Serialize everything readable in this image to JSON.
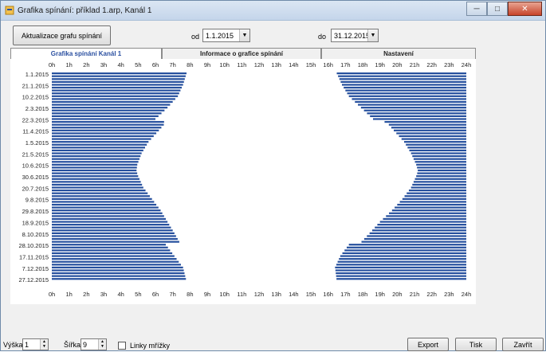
{
  "window": {
    "title": "Grafika spínání: příklad 1.arp, Kanál 1",
    "min_glyph": "─",
    "max_glyph": "□",
    "close_glyph": "✕"
  },
  "toolbar": {
    "refresh_label": "Aktualizace grafu spínání",
    "from_label": "od",
    "from_value": "1.1.2015",
    "to_label": "do",
    "to_value": "31.12.2015",
    "dropdown_glyph": "▼"
  },
  "tabs": [
    {
      "label": "Grafika spínání Kanál 1",
      "active": true
    },
    {
      "label": "Informace o grafice spínání",
      "active": false
    },
    {
      "label": "Nastavení",
      "active": false
    }
  ],
  "colors": {
    "bar": "#26509e",
    "tab_active_text": "#2a4fa0",
    "close_button": "#c7442b"
  },
  "chart_data": {
    "type": "bar",
    "orientation": "horizontal",
    "x_unit": "hour of day",
    "xlim": [
      0,
      24
    ],
    "x_ticks": [
      "0h",
      "1h",
      "2h",
      "3h",
      "4h",
      "5h",
      "6h",
      "7h",
      "8h",
      "9h",
      "10h",
      "11h",
      "12h",
      "13h",
      "14h",
      "15h",
      "16h",
      "17h",
      "18h",
      "19h",
      "20h",
      "21h",
      "22h",
      "23h",
      "24h"
    ],
    "y_tick_labels": [
      "1.1.2015",
      "21.1.2015",
      "10.2.2015",
      "2.3.2015",
      "22.3.2015",
      "11.4.2015",
      "1.5.2015",
      "21.5.2015",
      "10.6.2015",
      "30.6.2015",
      "20.7.2015",
      "9.8.2015",
      "29.8.2015",
      "18.9.2015",
      "8.10.2015",
      "28.10.2015",
      "17.11.2015",
      "7.12.2015",
      "27.12.2015"
    ],
    "description_of_rows": "one row per 5 days from 1.1.2015 to 31.12.2015; each row has a morning on-interval [0h, morning_off] and an evening on-interval [evening_on, 24h]",
    "row_step_days": 5,
    "keyframes": [
      {
        "date": "1.1.2015",
        "morning_off": 7.8,
        "evening_on": 16.5
      },
      {
        "date": "21.1.2015",
        "morning_off": 7.6,
        "evening_on": 16.8
      },
      {
        "date": "10.2.2015",
        "morning_off": 7.3,
        "evening_on": 17.2
      },
      {
        "date": "2.3.2015",
        "morning_off": 6.7,
        "evening_on": 17.9
      },
      {
        "date": "22.3.2015",
        "morning_off": 6.0,
        "evening_on": 18.6
      },
      {
        "date": "28.3.2015",
        "morning_off": 6.6,
        "evening_on": 19.4
      },
      {
        "date": "11.4.2015",
        "morning_off": 6.2,
        "evening_on": 19.8
      },
      {
        "date": "1.5.2015",
        "morning_off": 5.6,
        "evening_on": 20.4
      },
      {
        "date": "21.5.2015",
        "morning_off": 5.2,
        "evening_on": 20.8
      },
      {
        "date": "10.6.2015",
        "morning_off": 4.95,
        "evening_on": 21.1
      },
      {
        "date": "21.6.2015",
        "morning_off": 4.9,
        "evening_on": 21.2
      },
      {
        "date": "30.6.2015",
        "morning_off": 5.0,
        "evening_on": 21.1
      },
      {
        "date": "20.7.2015",
        "morning_off": 5.3,
        "evening_on": 20.8
      },
      {
        "date": "9.8.2015",
        "morning_off": 5.8,
        "evening_on": 20.3
      },
      {
        "date": "29.8.2015",
        "morning_off": 6.3,
        "evening_on": 19.7
      },
      {
        "date": "18.9.2015",
        "morning_off": 6.7,
        "evening_on": 19.0
      },
      {
        "date": "8.10.2015",
        "morning_off": 7.1,
        "evening_on": 18.4
      },
      {
        "date": "24.10.2015",
        "morning_off": 7.4,
        "evening_on": 17.9
      },
      {
        "date": "28.10.2015",
        "morning_off": 6.6,
        "evening_on": 17.2
      },
      {
        "date": "17.11.2015",
        "morning_off": 7.1,
        "evening_on": 16.7
      },
      {
        "date": "7.12.2015",
        "morning_off": 7.6,
        "evening_on": 16.4
      },
      {
        "date": "31.12.2015",
        "morning_off": 7.8,
        "evening_on": 16.5
      }
    ]
  },
  "statusbar": {
    "height_label": "Výška",
    "height_value": "1",
    "width_label": "Šířka",
    "width_value": "9",
    "grid_label": "Linky mřížky",
    "grid_checked": false,
    "export_label": "Export",
    "print_label": "Tisk",
    "close_label": "Zavřít"
  }
}
